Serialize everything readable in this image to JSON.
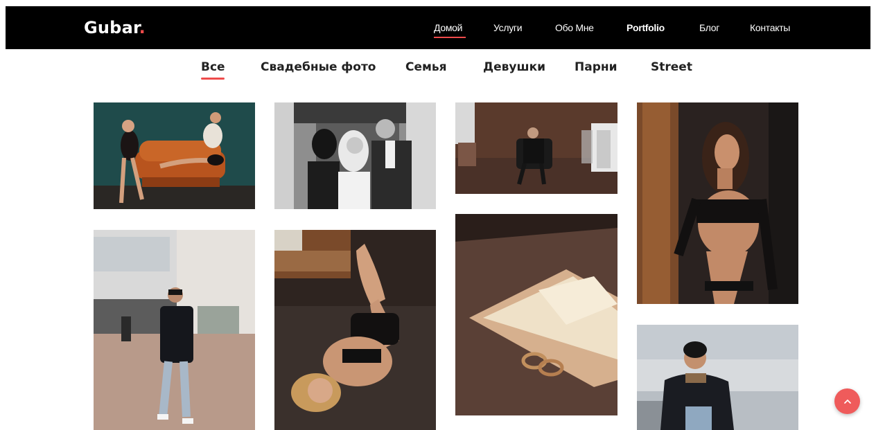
{
  "brand": {
    "name": "Gubar",
    "dot": ".",
    "accent_color": "#ef4b4b"
  },
  "nav": {
    "items": [
      {
        "label": "Домой",
        "active": true
      },
      {
        "label": "Услуги"
      },
      {
        "label": "Обо Мне"
      },
      {
        "label": "Portfolio",
        "bold": true
      },
      {
        "label": "Блог"
      },
      {
        "label": "Контакты"
      }
    ]
  },
  "filters": {
    "items": [
      {
        "label": "Все",
        "active": true
      },
      {
        "label": "Свадебные фото"
      },
      {
        "label": "Семья"
      },
      {
        "label": "Девушки"
      },
      {
        "label": "Парни"
      },
      {
        "label": "Street"
      }
    ]
  },
  "gallery": {
    "photos": [
      {
        "subject": "women on orange sofa"
      },
      {
        "subject": "wedding couple black and white"
      },
      {
        "subject": "man seated in armchair loft"
      },
      {
        "subject": "woman portrait dark"
      },
      {
        "subject": "man walking street"
      },
      {
        "subject": "woman lying on fur"
      },
      {
        "subject": "wedding rings on invitation"
      },
      {
        "subject": "man in black cap"
      }
    ]
  },
  "scroll_top": {
    "icon": "chevron-up-icon",
    "color": "#ef5b5b"
  }
}
